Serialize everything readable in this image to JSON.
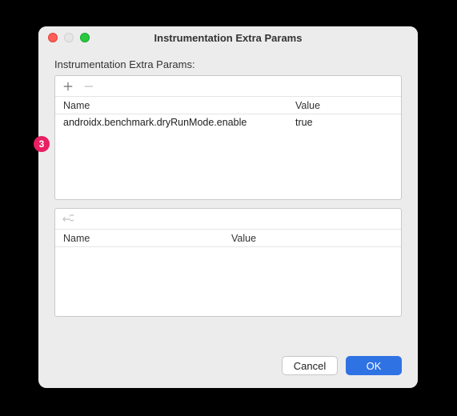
{
  "window": {
    "title": "Instrumentation Extra Params"
  },
  "header": {
    "label": "Instrumentation Extra Params:"
  },
  "topTable": {
    "columns": {
      "name": "Name",
      "value": "Value"
    },
    "rows": [
      {
        "name": "androidx.benchmark.dryRunMode.enable",
        "value": "true"
      }
    ]
  },
  "bottomTable": {
    "columns": {
      "name": "Name",
      "value": "Value"
    }
  },
  "buttons": {
    "cancel": "Cancel",
    "ok": "OK"
  },
  "annotation": {
    "badge": "3"
  }
}
